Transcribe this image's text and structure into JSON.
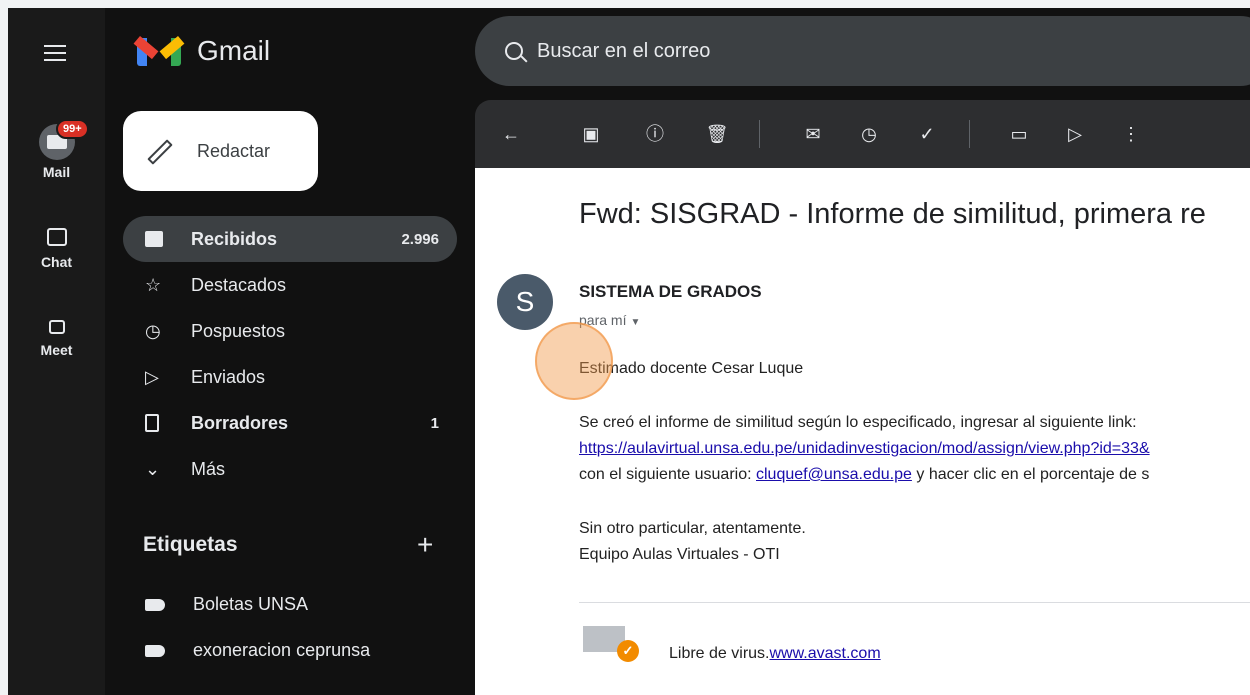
{
  "rail": {
    "mail": {
      "label": "Mail",
      "badge": "99+"
    },
    "chat": {
      "label": "Chat"
    },
    "meet": {
      "label": "Meet"
    }
  },
  "logo": {
    "text": "Gmail"
  },
  "compose": {
    "label": "Redactar"
  },
  "nav": [
    {
      "label": "Recibidos",
      "count": "2.996"
    },
    {
      "label": "Destacados",
      "count": ""
    },
    {
      "label": "Pospuestos",
      "count": ""
    },
    {
      "label": "Enviados",
      "count": ""
    },
    {
      "label": "Borradores",
      "count": "1"
    },
    {
      "label": "Más",
      "count": ""
    }
  ],
  "labels": {
    "title": "Etiquetas",
    "add": "+",
    "items": [
      "Boletas UNSA",
      "exoneracion ceprunsa"
    ]
  },
  "search": {
    "placeholder": "Buscar en el correo"
  },
  "email": {
    "subject": "Fwd: SISGRAD - Informe de similitud, primera re",
    "avatar_letter": "S",
    "sender": "SISTEMA DE GRADOS",
    "recipient": "para mí",
    "greeting": "Estimado docente Cesar Luque",
    "line1": "Se creó el informe de similitud según lo especificado, ingresar al siguiente link:",
    "link1": "https://aulavirtual.unsa.edu.pe/unidadinvestigacion/mod/assign/view.php?id=33&",
    "line3_prefix": "con el siguiente usuario: ",
    "line3_link": "cluquef@unsa.edu.pe",
    "line3_suffix": " y hacer clic en el porcentaje de s",
    "closing1": "Sin otro particular, atentamente.",
    "closing2": "Equipo Aulas Virtuales - OTI",
    "avast_prefix": "Libre de virus.",
    "avast_link": "www.avast.com"
  }
}
